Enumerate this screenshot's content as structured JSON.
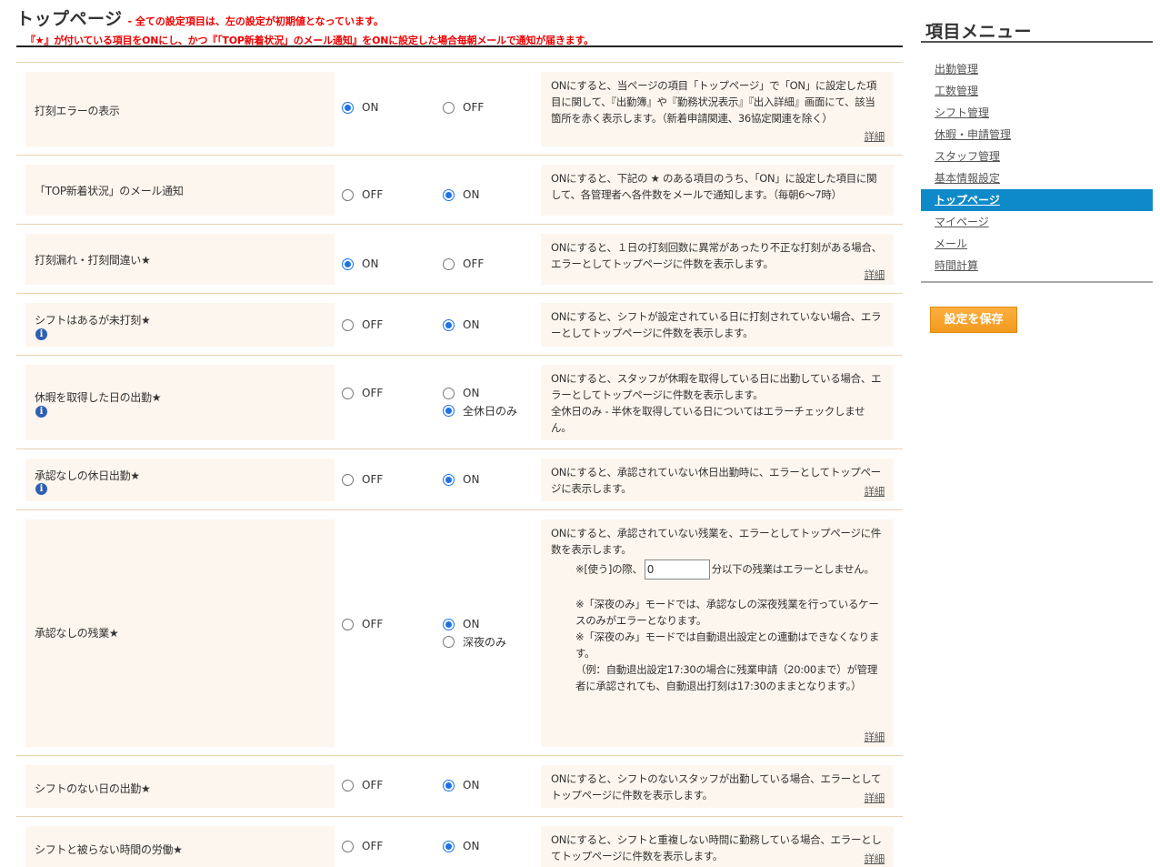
{
  "header": {
    "title": "トップページ",
    "subtitle": "- 全ての設定項目は、左の設定が初期値となっています。",
    "note": "『★』が付いている項目をONにし、かつ『「TOP新着状況」のメール通知』をONに設定した場合毎朝メールで通知が届きます。"
  },
  "rows": [
    {
      "label": "打刻エラーの表示",
      "options": [
        {
          "label": "ON",
          "checked": true
        },
        {
          "label": "OFF",
          "checked": false
        }
      ],
      "desc": [
        "ONにすると、当ページの項目「トップページ」で「ON」に設定した項目に関して、『出勤簿』や『勤務状況表示』『出入詳細』画面にて、該当箇所を赤く表示します。（新着申請関連、36協定関連を除く）"
      ],
      "detail": "詳細"
    },
    {
      "label": "「TOP新着状況」のメール通知",
      "options": [
        {
          "label": "OFF",
          "checked": false
        },
        {
          "label": "ON",
          "checked": true
        }
      ],
      "desc": [
        "ONにすると、下記の ★ のある項目のうち、「ON」に設定した項目に関して、各管理者へ各件数をメールで通知します。（毎朝6〜7時）"
      ]
    },
    {
      "label": "打刻漏れ・打刻間違い★",
      "options": [
        {
          "label": "ON",
          "checked": true
        },
        {
          "label": "OFF",
          "checked": false
        }
      ],
      "desc": [
        "ONにすると、１日の打刻回数に異常があったり不正な打刻がある場合、エラーとしてトップページに件数を表示します。"
      ],
      "detail": "詳細"
    },
    {
      "label": "シフトはあるが未打刻★",
      "options": [
        {
          "label": "OFF",
          "checked": false
        },
        {
          "label": "ON",
          "checked": true
        }
      ],
      "desc": [
        "ONにすると、シフトが設定されている日に打刻されていない場合、エラーとしてトップページに件数を表示します。"
      ]
    },
    {
      "label": "休暇を取得した日の出勤★",
      "options": [
        {
          "label": "OFF",
          "checked": false
        },
        {
          "label": "ON",
          "checked": false
        },
        {
          "label": "全休日のみ",
          "checked": true
        }
      ],
      "desc": [
        "ONにすると、スタッフが休暇を取得している日に出勤している場合、エラーとしてトップページに件数を表示します。",
        "全休日のみ - 半休を取得している日についてはエラーチェックしません。"
      ]
    },
    {
      "label": "承認なしの休日出勤★",
      "options": [
        {
          "label": "OFF",
          "checked": false
        },
        {
          "label": "ON",
          "checked": true
        }
      ],
      "desc": [
        "ONにすると、承認されていない休日出勤時に、エラーとしてトップページに表示します。"
      ],
      "detail": "詳細"
    },
    {
      "label": "承認なしの残業★",
      "options": [
        {
          "label": "OFF",
          "checked": false
        },
        {
          "label": "ON",
          "checked": true
        },
        {
          "label": "深夜のみ",
          "checked": false
        }
      ],
      "desc": [
        "ONにすると、承認されていない残業を、エラーとしてトップページに件数を表示します。",
        "※[使う]の際、",
        "分以下の残業はエラーとしません。",
        "※「深夜のみ」モードでは、承認なしの深夜残業を行っているケースのみがエラーとなります。",
        "※「深夜のみ」モードでは自動退出設定との連動はできなくなります。",
        "（例：自動退出設定17:30の場合に残業申請（20:00まで）が管理者に承認されても、自動退出打刻は17:30のままとなります。）"
      ],
      "input_value": "0",
      "detail": "詳細"
    },
    {
      "label": "シフトのない日の出勤★",
      "options": [
        {
          "label": "OFF",
          "checked": false
        },
        {
          "label": "ON",
          "checked": true
        }
      ],
      "desc": [
        "ONにすると、シフトのないスタッフが出勤している場合、エラーとしてトップページに件数を表示します。"
      ],
      "detail": "詳細"
    },
    {
      "label": "シフトと被らない時間の労働★",
      "options": [
        {
          "label": "OFF",
          "checked": false
        },
        {
          "label": "ON",
          "checked": true
        }
      ],
      "desc": [
        "ONにすると、シフトと重複しない時間に勤務している場合、エラーとしてトップページに件数を表示します。"
      ],
      "detail": "詳細"
    }
  ],
  "sidebar": {
    "title": "項目メニュー",
    "items": [
      {
        "label": "出勤管理",
        "active": false
      },
      {
        "label": "工数管理",
        "active": false
      },
      {
        "label": "シフト管理",
        "active": false
      },
      {
        "label": "休暇・申請管理",
        "active": false
      },
      {
        "label": "スタッフ管理",
        "active": false
      },
      {
        "label": "基本情報設定",
        "active": false
      },
      {
        "label": "トップページ",
        "active": true
      },
      {
        "label": "マイページ",
        "active": false
      },
      {
        "label": "メール",
        "active": false
      },
      {
        "label": "時間計算",
        "active": false
      }
    ],
    "save_label": "設定を保存"
  },
  "colors": {
    "accent": "#0e8ac9",
    "save_button": "#f39a1e",
    "cell_bg": "#fdf6ee",
    "row_border": "#e8d3b0",
    "warning_text": "#e00000",
    "radio_checked": "#1a73e8"
  },
  "icons": {
    "info": "info-icon"
  }
}
